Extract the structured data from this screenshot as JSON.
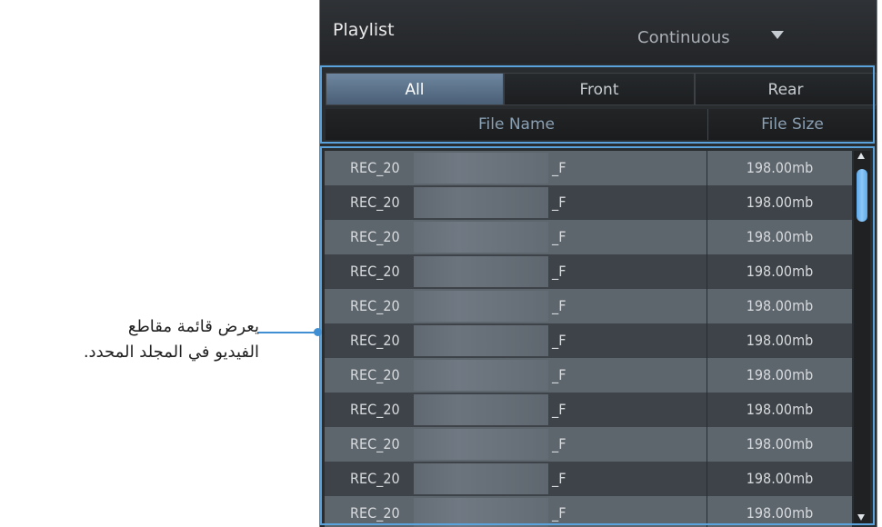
{
  "header": {
    "title": "Playlist",
    "mode": "Continuous"
  },
  "tabs": [
    {
      "label": "All",
      "active": true
    },
    {
      "label": "Front",
      "active": false
    },
    {
      "label": "Rear",
      "active": false
    }
  ],
  "columns": {
    "name": "File Name",
    "size": "File Size"
  },
  "files": [
    {
      "prefix": "REC_20",
      "suffix": "_F",
      "size": "198.00mb"
    },
    {
      "prefix": "REC_20",
      "suffix": "_F",
      "size": "198.00mb"
    },
    {
      "prefix": "REC_20",
      "suffix": "_F",
      "size": "198.00mb"
    },
    {
      "prefix": "REC_20",
      "suffix": "_F",
      "size": "198.00mb"
    },
    {
      "prefix": "REC_20",
      "suffix": "_F",
      "size": "198.00mb"
    },
    {
      "prefix": "REC_20",
      "suffix": "_F",
      "size": "198.00mb"
    },
    {
      "prefix": "REC_20",
      "suffix": "_F",
      "size": "198.00mb"
    },
    {
      "prefix": "REC_20",
      "suffix": "_F",
      "size": "198.00mb"
    },
    {
      "prefix": "REC_20",
      "suffix": "_F",
      "size": "198.00mb"
    },
    {
      "prefix": "REC_20",
      "suffix": "_F",
      "size": "198.00mb"
    },
    {
      "prefix": "REC_20",
      "suffix": "_F",
      "size": "198.00mb"
    }
  ],
  "annotation": {
    "text": "يعرض قائمة مقاطع الفيديو في المجلد المحدد."
  },
  "colors": {
    "accent": "#3f8fd2",
    "row_light": "#5d656d",
    "row_dark": "#3e4349",
    "active_tab": "#5b7390"
  }
}
